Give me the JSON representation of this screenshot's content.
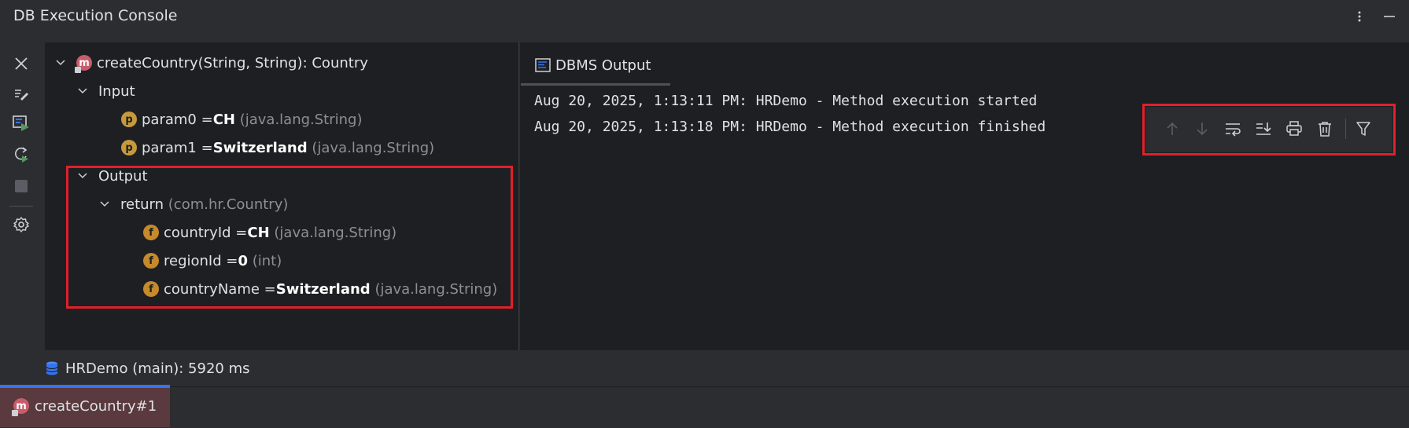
{
  "window": {
    "title": "DB Execution Console"
  },
  "header_icons": [
    "more-vertical-icon",
    "minimize-icon"
  ],
  "toolbar": {
    "items": [
      "close-icon",
      "edit-icon",
      "run-console-icon",
      "rerun-icon",
      "stop-icon",
      "settings-icon"
    ]
  },
  "tree": {
    "method": "createCountry(String, String): Country",
    "input_label": "Input",
    "params": [
      {
        "name": "param0 = ",
        "value": "CH",
        "type": "(java.lang.String)"
      },
      {
        "name": "param1 = ",
        "value": "Switzerland",
        "type": "(java.lang.String)"
      }
    ],
    "output_label": "Output",
    "return_label": "return",
    "return_type": "(com.hr.Country)",
    "fields": [
      {
        "name": "countryId = ",
        "value": "CH",
        "type": "(java.lang.String)"
      },
      {
        "name": "regionId = ",
        "value": "0",
        "type": "(int)"
      },
      {
        "name": "countryName = ",
        "value": "Switzerland",
        "type": "(java.lang.String)"
      }
    ]
  },
  "output_panel": {
    "tab_label": "DBMS Output",
    "lines": [
      "Aug 20, 2025, 1:13:11 PM: HRDemo - Method execution started",
      "Aug 20, 2025, 1:13:18 PM: HRDemo - Method execution finished"
    ],
    "floating_toolbar": [
      "arrow-up-icon",
      "arrow-down-icon",
      "soft-wrap-icon",
      "scroll-to-end-icon",
      "print-icon",
      "trash-icon",
      "filter-icon"
    ]
  },
  "status": {
    "text": "HRDemo (main): 5920 ms"
  },
  "bottom_tab": {
    "label": "createCountry#1"
  },
  "colors": {
    "highlight": "#e0202a",
    "accent": "#3574f0"
  }
}
